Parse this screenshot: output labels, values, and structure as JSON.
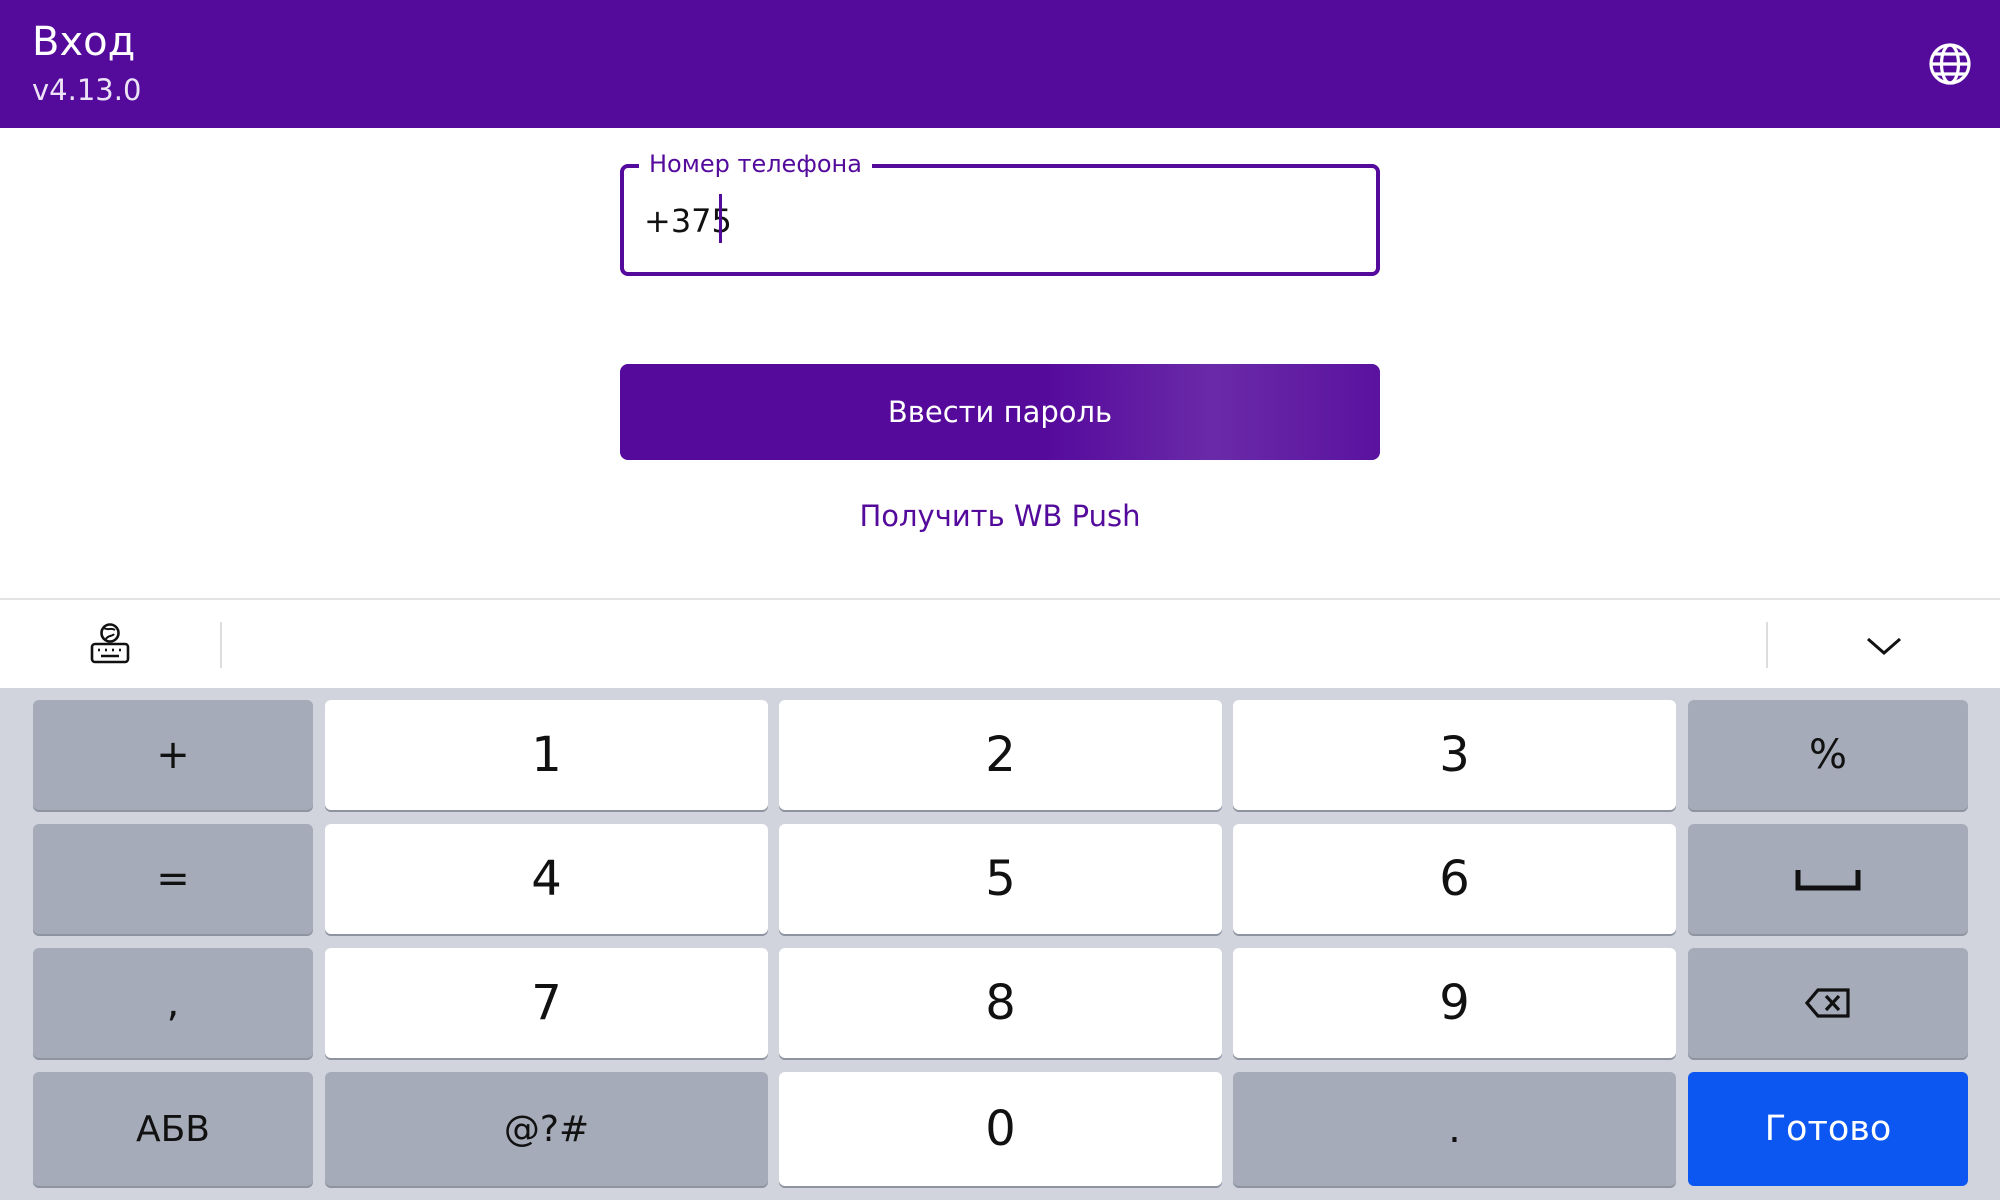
{
  "app_bar": {
    "title": "Вход",
    "version": "v4.13.0",
    "language_icon": "globe-icon"
  },
  "login_form": {
    "phone_label": "Номер телефона",
    "phone_value": "+375",
    "submit_label": "Ввести пароль",
    "push_link_label": "Получить WB Push"
  },
  "keyboard": {
    "toolbar": {
      "switch_icon": "keyboard-globe-icon",
      "hide_icon": "chevron-down-icon"
    },
    "rows": [
      [
        "+",
        "1",
        "2",
        "3",
        "%"
      ],
      [
        "=",
        "4",
        "5",
        "6",
        "space"
      ],
      [
        ",",
        "7",
        "8",
        "9",
        "backspace"
      ],
      [
        "АБВ",
        "@?#",
        "0",
        ".",
        "Готово"
      ]
    ]
  },
  "colors": {
    "brand": "#540b9c",
    "keyboard_background": "#d1d4dd",
    "key_light": "#ffffff",
    "key_dark": "#a5abb8",
    "done_key": "#0c57f1"
  }
}
